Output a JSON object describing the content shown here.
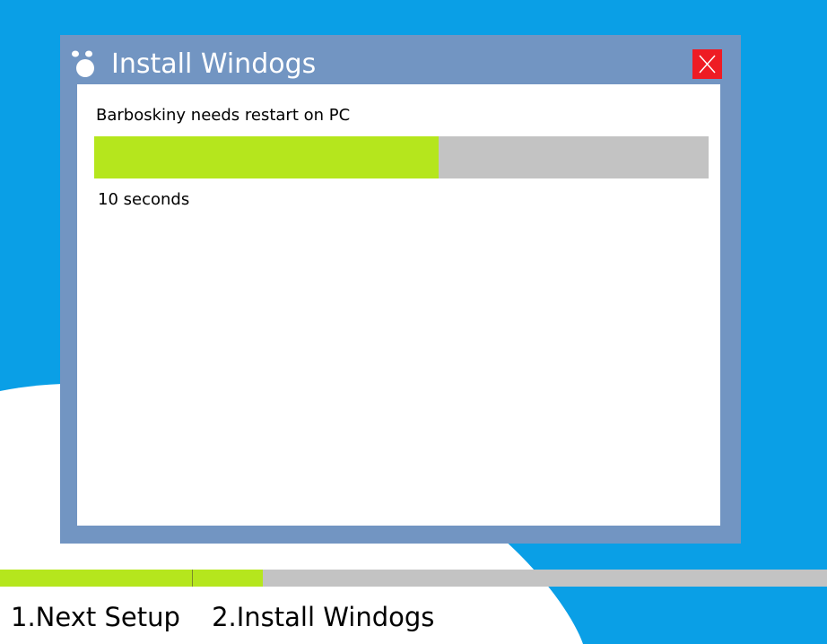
{
  "window": {
    "title": "Install Windogs",
    "app_icon": "paw-icon",
    "close_icon": "close-icon"
  },
  "dialog": {
    "message": "Barboskiny needs restart on PC",
    "countdown": "10 seconds",
    "progress_fraction": 0.56
  },
  "steps": {
    "items": [
      "1.Next Setup",
      "2.Install Windogs"
    ],
    "progress_fraction": 0.318
  },
  "colors": {
    "desktop_blue": "#0a9fe6",
    "dialog_frame": "#7295c2",
    "progress_green": "#b5e61d",
    "progress_gray": "#c3c3c3",
    "close_red": "#ee1c24"
  }
}
